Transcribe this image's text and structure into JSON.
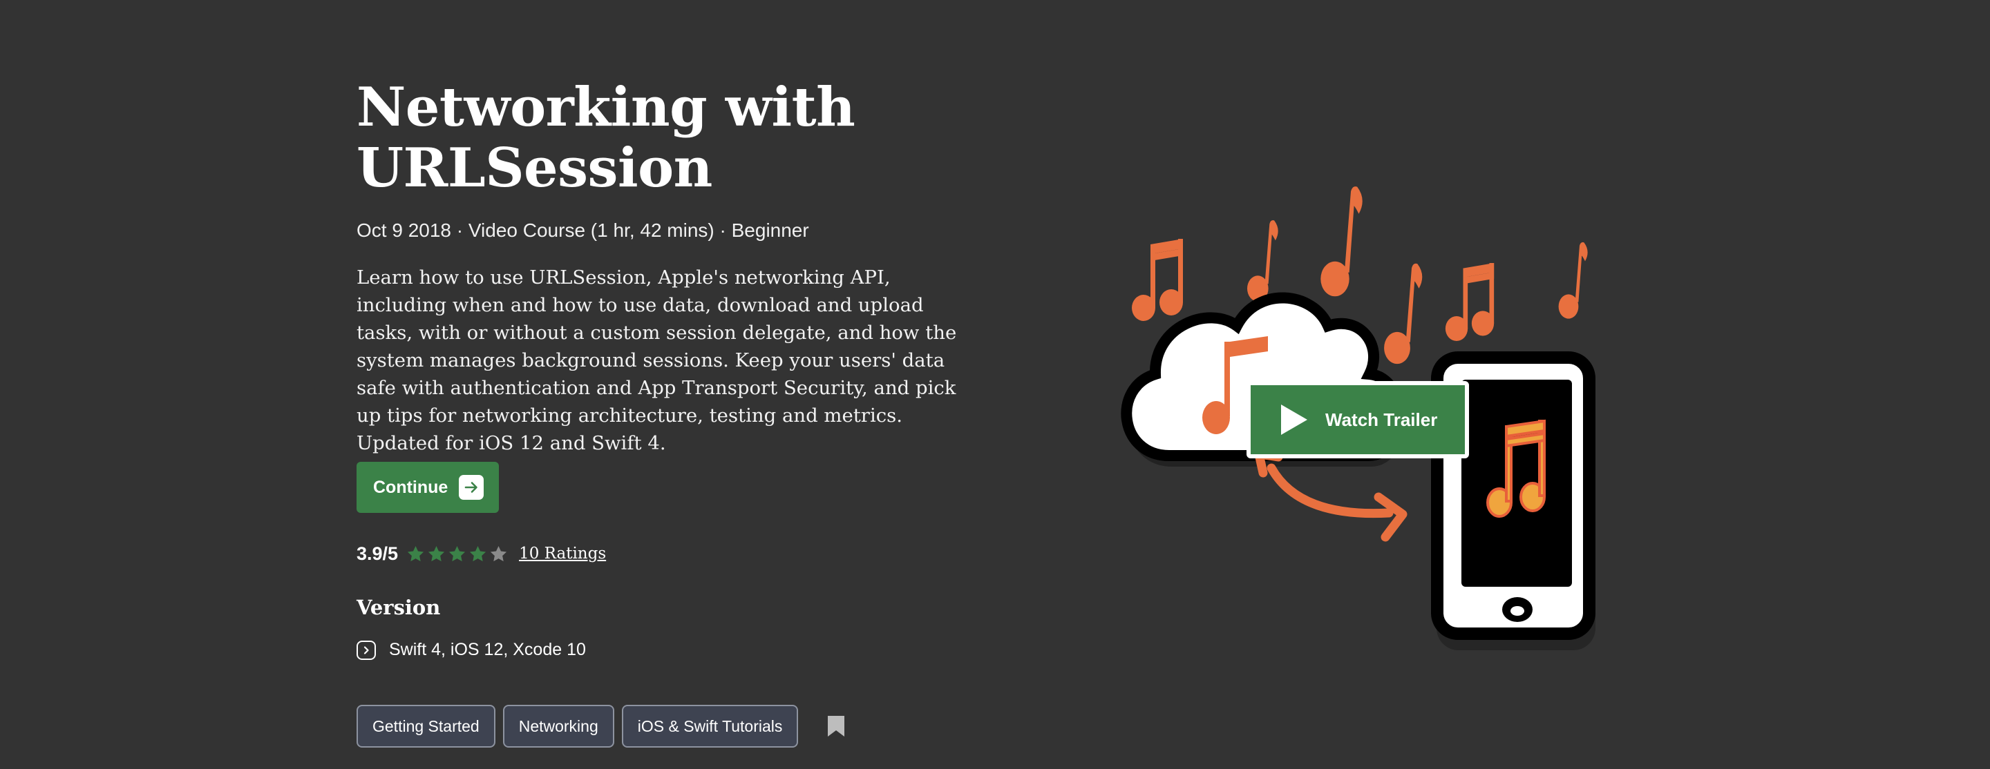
{
  "course": {
    "title": "Networking with URLSession",
    "meta": "Oct 9 2018 · Video Course (1 hr, 42 mins) · Beginner",
    "description": "Learn how to use URLSession, Apple's networking API, including when and how to use data, download and upload tasks, with or without a custom session delegate, and how the system manages background sessions. Keep your users' data safe with authentication and App Transport Security, and pick up tips for networking architecture, testing and metrics. Updated for iOS 12 and Swift 4."
  },
  "actions": {
    "continue_label": "Continue",
    "watch_trailer_label": "Watch Trailer"
  },
  "rating": {
    "score": "3.9/5",
    "value": 3.9,
    "max": 5,
    "ratings_link": "10 Ratings"
  },
  "version": {
    "heading": "Version",
    "value": "Swift 4, iOS 12, Xcode 10"
  },
  "tags": [
    "Getting Started",
    "Networking",
    "iOS & Swift Tutorials"
  ],
  "icons": {
    "continue": "arrow-right-icon",
    "version": "chevron-right-icon",
    "bookmark": "bookmark-icon",
    "trailer": "play-icon",
    "stars": "star-icon"
  },
  "colors": {
    "background": "#333333",
    "accent_green": "#3b8248",
    "star_filled": "#3b8248",
    "star_empty": "#8a8a8a",
    "tag_bg": "#3e4351",
    "tag_border": "#8d93a0",
    "music_orange": "#e8703f"
  }
}
